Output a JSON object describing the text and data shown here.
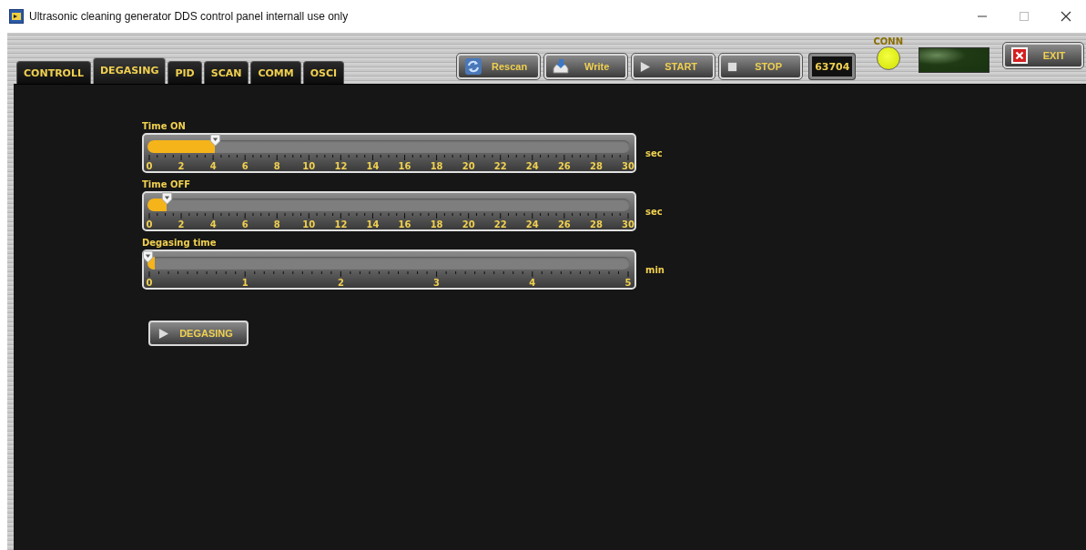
{
  "window": {
    "title": "Ultrasonic cleaning generator DDS control panel internall use only"
  },
  "tabs": [
    {
      "label": "CONTROLL",
      "selected": false
    },
    {
      "label": "DEGASING",
      "selected": true
    },
    {
      "label": "PID",
      "selected": false
    },
    {
      "label": "SCAN",
      "selected": false
    },
    {
      "label": "COMM",
      "selected": false
    },
    {
      "label": "OSCI",
      "selected": false
    }
  ],
  "toolbar": {
    "buttons": [
      {
        "label": "Rescan",
        "kind": "refresh"
      },
      {
        "label": "Write",
        "kind": "write"
      },
      {
        "label": "START",
        "kind": "play"
      },
      {
        "label": "STOP",
        "kind": "stop"
      }
    ],
    "counter": "63704",
    "connection": {
      "label": "CONN",
      "on": true
    },
    "exit_button": "EXIT"
  },
  "sliders": [
    {
      "label": "Time ON",
      "level": 0.14,
      "ticks": [
        "0",
        "2",
        "4",
        "6",
        "8",
        "10",
        "12",
        "14",
        "16",
        "18",
        "20",
        "22",
        "24",
        "26",
        "28",
        "30"
      ],
      "unit": "sec"
    },
    {
      "label": "Time OFF",
      "level": 0.04,
      "ticks": [
        "0",
        "2",
        "4",
        "6",
        "8",
        "10",
        "12",
        "14",
        "16",
        "18",
        "20",
        "22",
        "24",
        "26",
        "28",
        "30"
      ],
      "unit": "sec"
    },
    {
      "label": "Degasing time",
      "level": 0.0,
      "ticks": [
        "0",
        "1",
        "2",
        "3",
        "4",
        "5"
      ],
      "unit": "min"
    }
  ],
  "degasing_button": "DEGASING"
}
